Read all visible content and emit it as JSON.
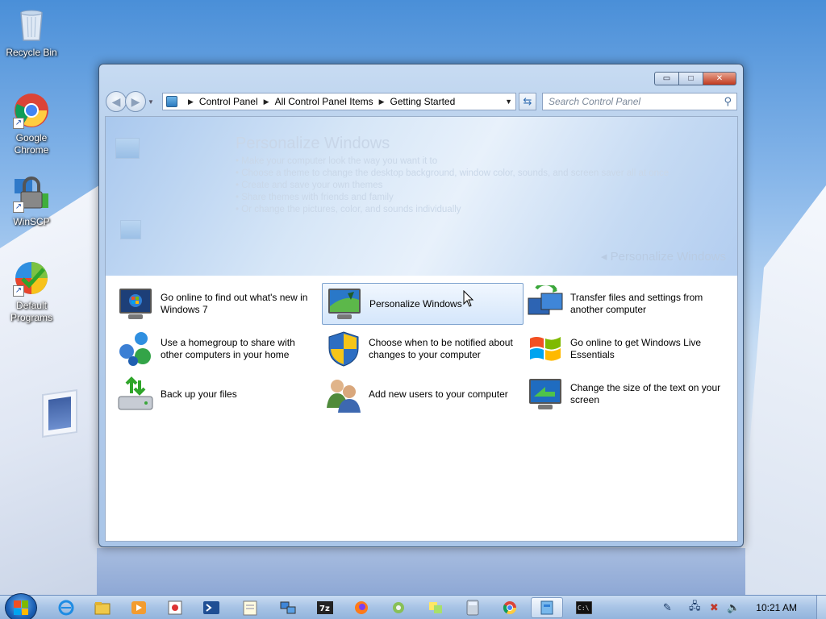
{
  "desktop": {
    "icons": [
      {
        "label": "Recycle Bin"
      },
      {
        "label": "Google Chrome"
      },
      {
        "label": "WinSCP"
      },
      {
        "label": "Default Programs"
      }
    ]
  },
  "window": {
    "controls": {
      "minimize": "▭",
      "maximize": "□",
      "close": "✕"
    },
    "breadcrumb": [
      "Control Panel",
      "All Control Panel Items",
      "Getting Started"
    ],
    "search_placeholder": "Search Control Panel",
    "banner": {
      "title": "Personalize Windows",
      "bullets": [
        "Make your computer look the way you want it to",
        "Choose a theme to change the desktop background, window color, sounds, and screen saver all at once",
        "Create and save your own themes",
        "Share themes with friends and family",
        "Or change the pictures, color, and sounds individually"
      ],
      "link": "Personalize Windows"
    },
    "tasks": [
      {
        "label": "Go online to find out what's new in Windows 7",
        "icon": "monitor-windows-icon"
      },
      {
        "label": "Personalize Windows",
        "icon": "personalize-icon",
        "selected": true
      },
      {
        "label": "Transfer files and settings from another computer",
        "icon": "transfer-icon"
      },
      {
        "label": "Use a homegroup to share with other computers in your home",
        "icon": "homegroup-icon"
      },
      {
        "label": "Choose when to be notified about changes to your computer",
        "icon": "uac-shield-icon"
      },
      {
        "label": "Go online to get Windows Live Essentials",
        "icon": "windows-flag-icon"
      },
      {
        "label": "Back up your files",
        "icon": "backup-icon"
      },
      {
        "label": "Add new users to your computer",
        "icon": "users-icon"
      },
      {
        "label": "Change the size of the text on your screen",
        "icon": "display-text-icon"
      }
    ]
  },
  "taskbar": {
    "items": [
      "ie-icon",
      "explorer-icon",
      "media-player-icon",
      "paint-icon",
      "powershell-icon",
      "notepad-icon",
      "network-icon",
      "7zip-icon",
      "firefox-icon",
      "app-icon",
      "sticky-notes-icon",
      "calculator-icon",
      "chrome-icon",
      "control-panel-icon",
      "cmd-icon"
    ],
    "clock": "10:21 AM"
  }
}
